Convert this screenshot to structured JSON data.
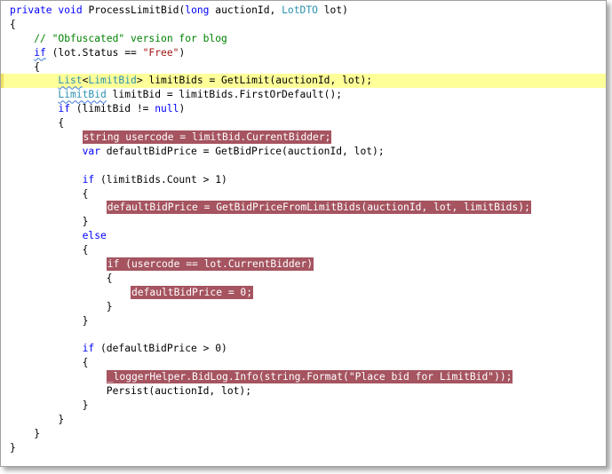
{
  "editor": {
    "theme": {
      "keyword": "#0000ff",
      "type": "#2b91af",
      "string": "#a31515",
      "comment": "#008000",
      "breakpoint_bg": "#a55460",
      "current_line_bg": "#ffff99"
    },
    "lines": [
      {
        "indent": 0,
        "segments": [
          {
            "t": "private",
            "c": "kw"
          },
          {
            "t": " ",
            "c": "plain"
          },
          {
            "t": "void",
            "c": "kw"
          },
          {
            "t": " ProcessLimitBid(",
            "c": "plain"
          },
          {
            "t": "long",
            "c": "kw"
          },
          {
            "t": " auctionId, ",
            "c": "plain"
          },
          {
            "t": "LotDTO",
            "c": "type"
          },
          {
            "t": " lot)",
            "c": "plain"
          }
        ]
      },
      {
        "indent": 0,
        "segments": [
          {
            "t": "{",
            "c": "plain"
          }
        ]
      },
      {
        "indent": 4,
        "segments": [
          {
            "t": "// \"Obfuscated\" version for blog",
            "c": "comment"
          }
        ]
      },
      {
        "indent": 4,
        "segments": [
          {
            "t": "if",
            "c": "kw",
            "squiggle": true
          },
          {
            "t": " (lot.Status == ",
            "c": "plain"
          },
          {
            "t": "\"Free\"",
            "c": "str"
          },
          {
            "t": ")",
            "c": "plain"
          }
        ]
      },
      {
        "indent": 4,
        "segments": [
          {
            "t": "{",
            "c": "plain"
          }
        ]
      },
      {
        "indent": 8,
        "highlight": "current",
        "segments": [
          {
            "t": "List",
            "c": "type",
            "squiggle": true
          },
          {
            "t": "<",
            "c": "plain"
          },
          {
            "t": "LimitBid",
            "c": "type"
          },
          {
            "t": "> limitBids = GetLimit(auctionId, lot);",
            "c": "plain"
          }
        ]
      },
      {
        "indent": 8,
        "segments": [
          {
            "t": "LimitBid",
            "c": "type",
            "squiggle": true
          },
          {
            "t": " limitBid = limitBids.FirstOrDefault();",
            "c": "plain"
          }
        ]
      },
      {
        "indent": 8,
        "segments": [
          {
            "t": "if",
            "c": "kw"
          },
          {
            "t": " (limitBid != ",
            "c": "plain"
          },
          {
            "t": "null",
            "c": "kw"
          },
          {
            "t": ")",
            "c": "plain"
          }
        ]
      },
      {
        "indent": 8,
        "segments": [
          {
            "t": "{",
            "c": "plain"
          }
        ]
      },
      {
        "indent": 12,
        "highlight": "breakpoint",
        "segments": [
          {
            "t": "string usercode = limitBid.CurrentBidder;",
            "c": "plain"
          }
        ]
      },
      {
        "indent": 12,
        "segments": [
          {
            "t": "var",
            "c": "kw"
          },
          {
            "t": " defaultBidPrice = GetBidPrice(auctionId, lot);",
            "c": "plain"
          }
        ]
      },
      {
        "indent": 0,
        "segments": []
      },
      {
        "indent": 12,
        "segments": [
          {
            "t": "if",
            "c": "kw"
          },
          {
            "t": " (limitBids.Count > 1)",
            "c": "plain"
          }
        ]
      },
      {
        "indent": 12,
        "segments": [
          {
            "t": "{",
            "c": "plain"
          }
        ]
      },
      {
        "indent": 16,
        "highlight": "breakpoint",
        "segments": [
          {
            "t": "defaultBidPrice = GetBidPriceFromLimitBids(auctionId, lot, limitBids);",
            "c": "plain"
          }
        ]
      },
      {
        "indent": 12,
        "segments": [
          {
            "t": "}",
            "c": "plain"
          }
        ]
      },
      {
        "indent": 12,
        "segments": [
          {
            "t": "else",
            "c": "kw"
          }
        ]
      },
      {
        "indent": 12,
        "segments": [
          {
            "t": "{",
            "c": "plain"
          }
        ]
      },
      {
        "indent": 16,
        "highlight": "breakpoint",
        "segments": [
          {
            "t": "if (usercode == lot.CurrentBidder)",
            "c": "plain"
          }
        ]
      },
      {
        "indent": 16,
        "segments": [
          {
            "t": "{",
            "c": "plain"
          }
        ]
      },
      {
        "indent": 20,
        "highlight": "breakpoint",
        "segments": [
          {
            "t": "defaultBidPrice = 0;",
            "c": "plain"
          }
        ]
      },
      {
        "indent": 16,
        "segments": [
          {
            "t": "}",
            "c": "plain"
          }
        ]
      },
      {
        "indent": 12,
        "segments": [
          {
            "t": "}",
            "c": "plain"
          }
        ]
      },
      {
        "indent": 0,
        "segments": []
      },
      {
        "indent": 12,
        "segments": [
          {
            "t": "if",
            "c": "kw"
          },
          {
            "t": " (defaultBidPrice > 0)",
            "c": "plain"
          }
        ]
      },
      {
        "indent": 12,
        "segments": [
          {
            "t": "{",
            "c": "plain"
          }
        ]
      },
      {
        "indent": 16,
        "highlight": "breakpoint",
        "segments": [
          {
            "t": "_loggerHelper.BidLog.Info(string.Format(\"Place bid for LimitBid\"));",
            "c": "plain"
          }
        ]
      },
      {
        "indent": 16,
        "segments": [
          {
            "t": "Persist(auctionId, lot);",
            "c": "plain"
          }
        ]
      },
      {
        "indent": 12,
        "segments": [
          {
            "t": "}",
            "c": "plain"
          }
        ]
      },
      {
        "indent": 8,
        "segments": [
          {
            "t": "}",
            "c": "plain"
          }
        ]
      },
      {
        "indent": 4,
        "segments": [
          {
            "t": "}",
            "c": "plain"
          }
        ]
      },
      {
        "indent": 0,
        "segments": [
          {
            "t": "}",
            "c": "plain"
          }
        ]
      }
    ]
  }
}
